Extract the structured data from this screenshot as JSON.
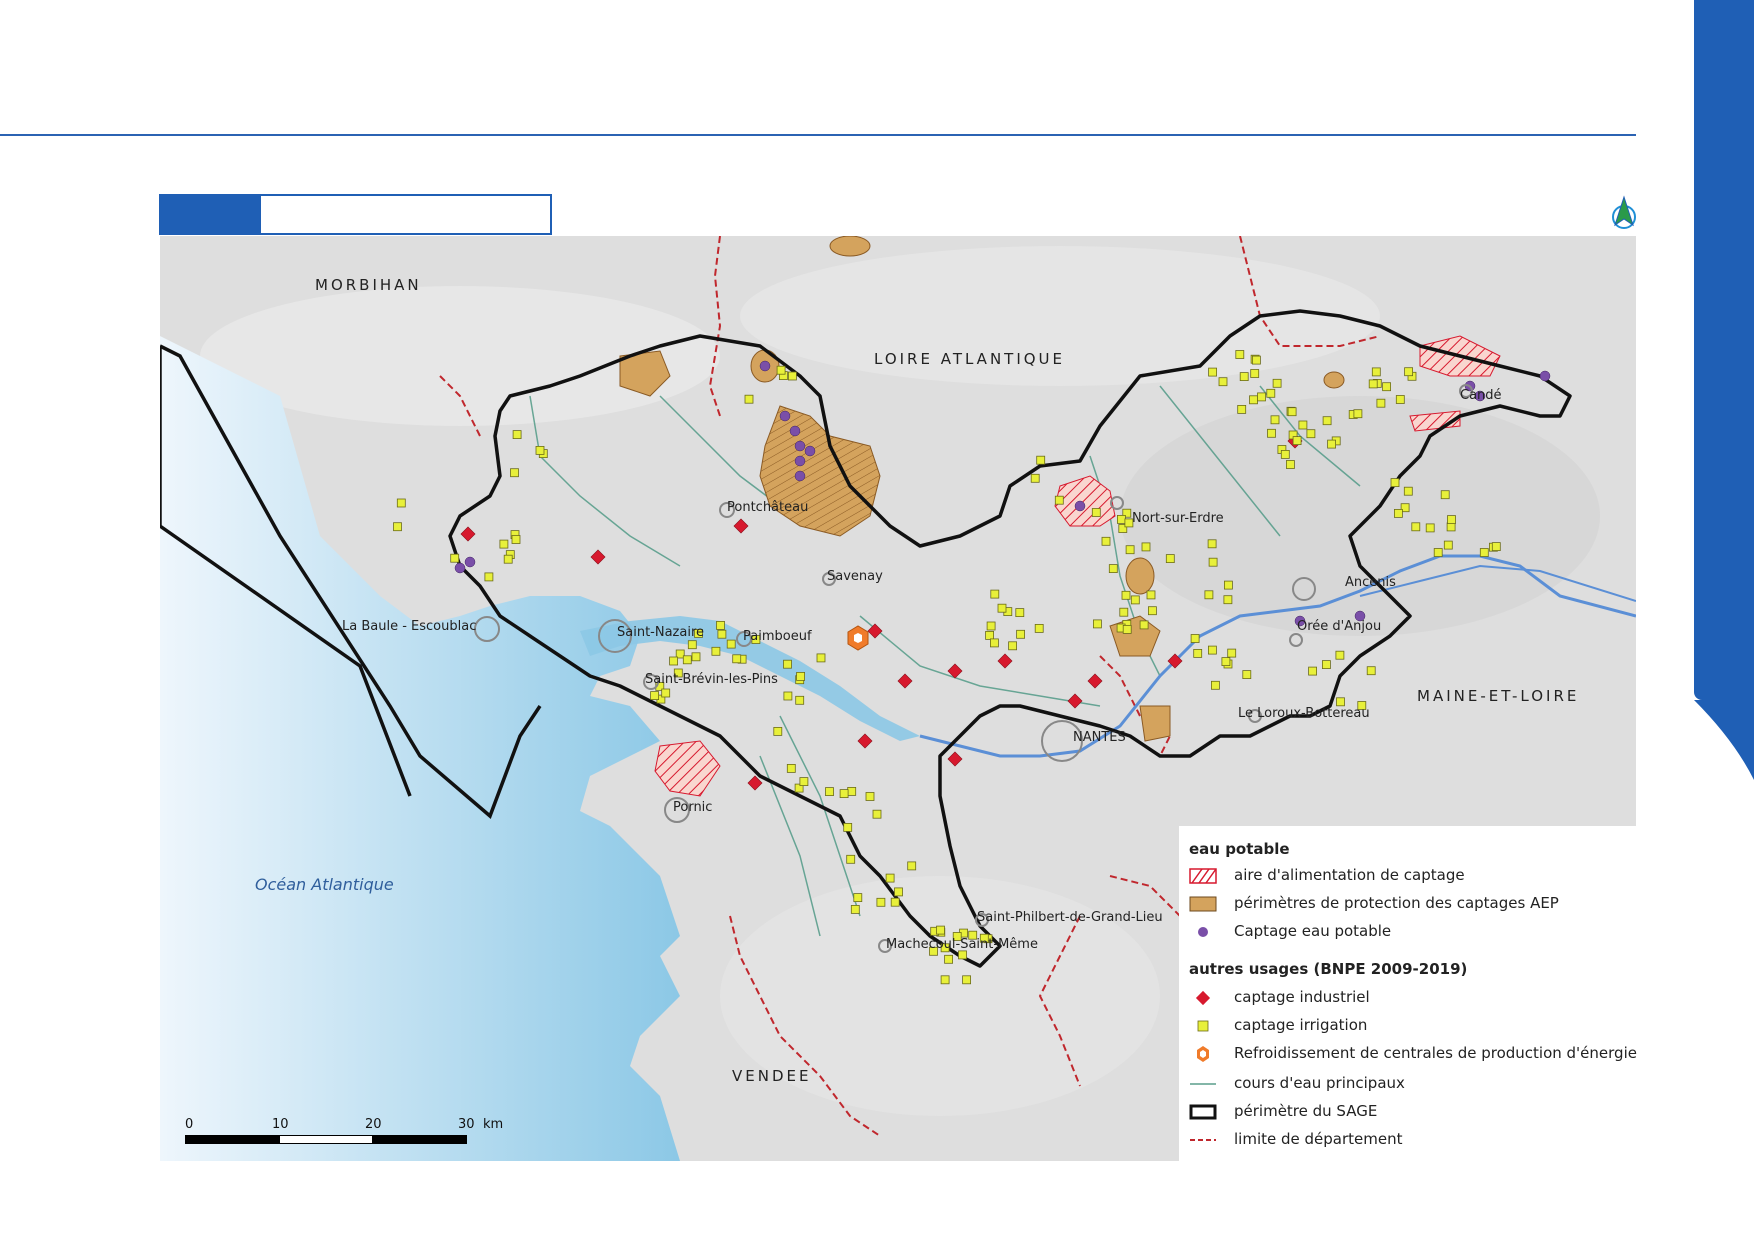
{
  "page": {
    "accent_color": "#1f5fb5",
    "title_tag": "",
    "title_text": ""
  },
  "map": {
    "ocean_label": "Océan Atlantique",
    "regions": [
      {
        "id": "morbihan",
        "label": "MORBIHAN"
      },
      {
        "id": "loire-atlantique",
        "label": "LOIRE ATLANTIQUE"
      },
      {
        "id": "maine-et-loire",
        "label": "MAINE-ET-LOIRE"
      },
      {
        "id": "vendee",
        "label": "VENDEE"
      }
    ],
    "places": [
      {
        "id": "la-baule",
        "label": "La Baule - Escoublac"
      },
      {
        "id": "saint-nazaire",
        "label": "Saint-Nazaire"
      },
      {
        "id": "paimboeuf",
        "label": "Paimboeuf"
      },
      {
        "id": "saint-brevin",
        "label": "Saint-Brévin-les-Pins"
      },
      {
        "id": "pornic",
        "label": "Pornic"
      },
      {
        "id": "pontchateau",
        "label": "Pontchâteau"
      },
      {
        "id": "savenay",
        "label": "Savenay"
      },
      {
        "id": "nort-sur-erdre",
        "label": "Nort-sur-Erdre"
      },
      {
        "id": "nantes",
        "label": "NANTES"
      },
      {
        "id": "le-loroux",
        "label": "Le Loroux-Bottereau"
      },
      {
        "id": "ancenis",
        "label": "Ancenis"
      },
      {
        "id": "oree-d-anjou",
        "label": "Orée d'Anjou"
      },
      {
        "id": "cande",
        "label": "Candé"
      },
      {
        "id": "saint-philbert",
        "label": "Saint-Philbert-de-Grand-Lieu"
      },
      {
        "id": "machecoul",
        "label": "Machecoul-Saint-Même"
      }
    ],
    "colors": {
      "sea": "#8cc8e6",
      "land": "#dcdcdc",
      "sage_border": "#111111",
      "dept_border": "#c0272d",
      "river": "#5a9e8c",
      "loire": "#5b8fd6",
      "industrial": "#d7192e",
      "irrigation": "#e8f03a",
      "drinking": "#7a4fa8",
      "protection": "#d4a35d",
      "energy": "#f07b2a"
    }
  },
  "legend": {
    "group1_title": "eau potable",
    "aac": "aire d'alimentation de captage",
    "perimetres": "périmètres de protection des captages AEP",
    "captage_ep": "Captage eau potable",
    "group2_title": "autres usages (BNPE 2009-2019)",
    "industriel": "captage industriel",
    "irrigation": "captage irrigation",
    "refroidissement": "Refroidissement de centrales de production d'énergie",
    "cours_eau": "cours d'eau principaux",
    "perimetre_sage": "périmètre du SAGE",
    "limite_dept": "limite de département"
  },
  "scale": {
    "ticks": [
      "0",
      "10",
      "20",
      "30"
    ],
    "unit": "km"
  }
}
